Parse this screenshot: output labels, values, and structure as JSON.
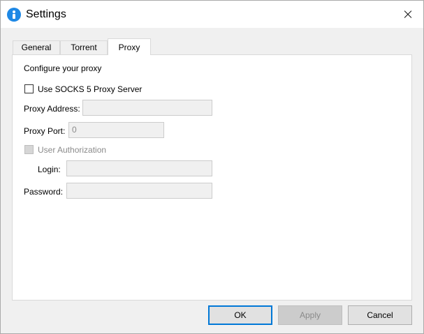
{
  "window": {
    "title": "Settings"
  },
  "tabs": [
    {
      "label": "General"
    },
    {
      "label": "Torrent"
    },
    {
      "label": "Proxy"
    }
  ],
  "proxy": {
    "heading": "Configure your proxy",
    "use_socks_label": "Use SOCKS 5 Proxy Server",
    "address_label": "Proxy Address:",
    "address_value": "",
    "port_label": "Proxy Port:",
    "port_value": "0",
    "auth_label": "User Authorization",
    "login_label": "Login:",
    "login_value": "",
    "password_label": "Password:",
    "password_value": ""
  },
  "buttons": {
    "ok": "OK",
    "apply": "Apply",
    "cancel": "Cancel"
  }
}
